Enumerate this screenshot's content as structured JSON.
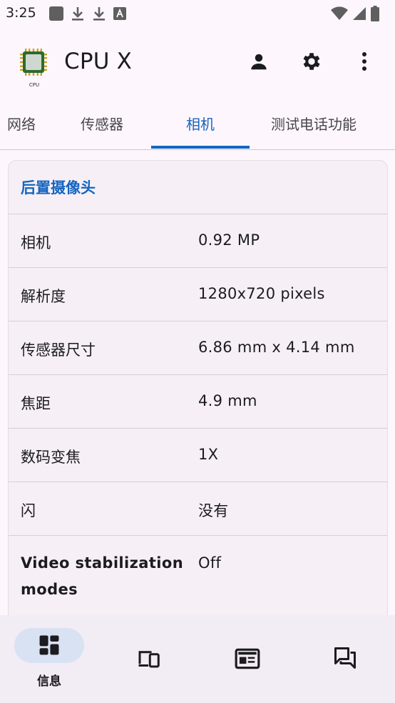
{
  "status_bar": {
    "time": "3:25"
  },
  "app_bar": {
    "logo_text": "CPU",
    "title": "CPU X"
  },
  "tabs": [
    {
      "label": "网络"
    },
    {
      "label": "传感器"
    },
    {
      "label": "相机"
    },
    {
      "label": "测试电话功能"
    }
  ],
  "card": {
    "title": "后置摄像头",
    "rows": [
      {
        "key": "相机",
        "value": "0.92 MP"
      },
      {
        "key": "解析度",
        "value": "1280x720 pixels"
      },
      {
        "key": "传感器尺寸",
        "value": "6.86 mm x 4.14 mm"
      },
      {
        "key": "焦距",
        "value": "4.9 mm"
      },
      {
        "key": "数码变焦",
        "value": "1X"
      },
      {
        "key": "闪",
        "value": "没有"
      },
      {
        "key": "Video stabilization modes",
        "value": "Off"
      }
    ]
  },
  "bottom_nav": {
    "items": [
      {
        "label": "信息",
        "icon": "dashboard-icon"
      },
      {
        "icon": "devices-icon"
      },
      {
        "icon": "newspaper-icon"
      },
      {
        "icon": "forum-icon"
      }
    ]
  },
  "colors": {
    "accent": "#1565c0",
    "background": "#fdf7fd",
    "card": "#f6f0f6"
  }
}
